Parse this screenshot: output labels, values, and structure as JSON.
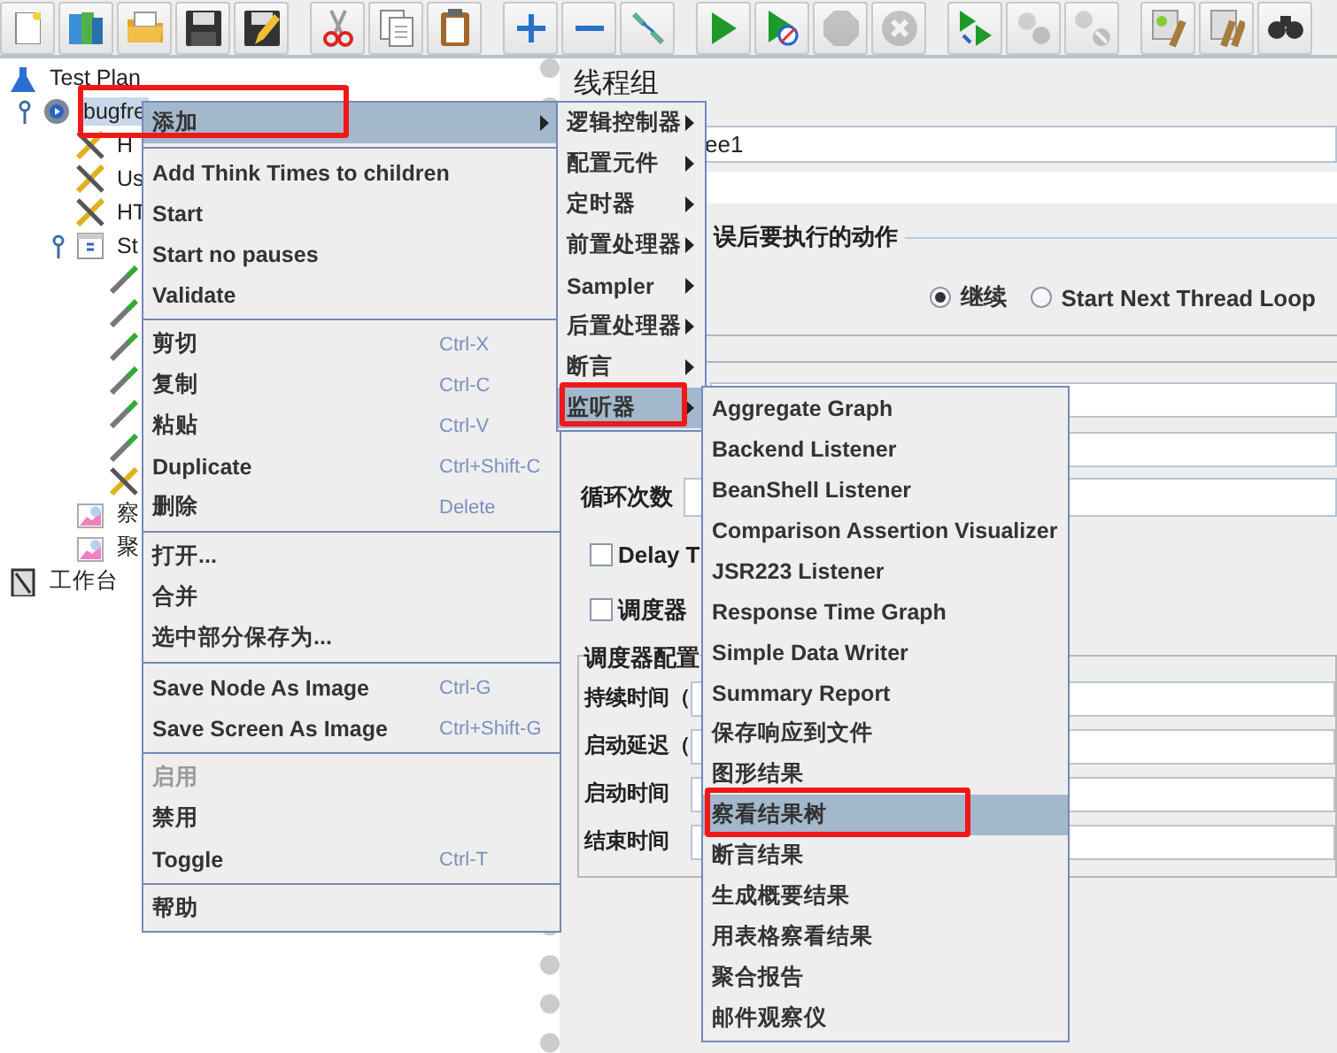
{
  "toolbar": [
    [
      {
        "kind": "new",
        "disabled": false
      },
      {
        "kind": "templates",
        "disabled": false
      },
      {
        "kind": "open",
        "disabled": false
      },
      {
        "kind": "save",
        "disabled": false
      },
      {
        "kind": "save-as",
        "disabled": false
      }
    ],
    [
      {
        "kind": "cut",
        "disabled": false
      },
      {
        "kind": "copy",
        "disabled": false
      },
      {
        "kind": "paste",
        "disabled": false
      }
    ],
    [
      {
        "kind": "expand",
        "disabled": false
      },
      {
        "kind": "collapse",
        "disabled": false
      },
      {
        "kind": "toggle",
        "disabled": false
      }
    ],
    [
      {
        "kind": "start",
        "disabled": false
      },
      {
        "kind": "start-no-pauses",
        "disabled": false
      },
      {
        "kind": "stop",
        "disabled": true
      },
      {
        "kind": "shutdown",
        "disabled": true
      }
    ],
    [
      {
        "kind": "remote-start",
        "disabled": false
      },
      {
        "kind": "remote-stop",
        "disabled": true
      },
      {
        "kind": "remote-shutdown",
        "disabled": true
      }
    ],
    [
      {
        "kind": "clear",
        "disabled": false
      },
      {
        "kind": "clear-all",
        "disabled": false
      },
      {
        "kind": "search",
        "disabled": false
      }
    ]
  ],
  "tree": [
    {
      "label": "Test Plan",
      "kind": "test-plan",
      "selected": false,
      "children": [
        {
          "label": "bugfre",
          "kind": "thread-group",
          "selected": true,
          "expanded": true,
          "children": [
            {
              "label": "H",
              "kind": "config",
              "selected": false
            },
            {
              "label": "Us",
              "kind": "config",
              "selected": false
            },
            {
              "label": "HT",
              "kind": "config",
              "selected": false
            },
            {
              "label": "St",
              "kind": "controller",
              "selected": false,
              "expanded": true,
              "children": [
                {
                  "kind": "sampler",
                  "selected": false
                },
                {
                  "kind": "sampler",
                  "selected": false
                },
                {
                  "kind": "sampler",
                  "selected": false
                },
                {
                  "kind": "sampler",
                  "selected": false
                },
                {
                  "kind": "sampler",
                  "selected": false
                },
                {
                  "kind": "sampler",
                  "selected": false
                },
                {
                  "kind": "config",
                  "selected": false
                }
              ]
            },
            {
              "label": "察",
              "kind": "listener",
              "selected": false
            },
            {
              "label": "聚",
              "kind": "listener",
              "selected": false
            }
          ]
        }
      ]
    },
    {
      "label": "工作台",
      "kind": "workbench",
      "selected": false
    }
  ],
  "editor": {
    "title": "线程组",
    "name_value": "ee1",
    "error_section": "误后要执行的动作",
    "error_actions": [
      {
        "label": "继续",
        "selected": true
      },
      {
        "label": "Start Next Thread Loop",
        "selected": false
      }
    ],
    "loop_label": "循环次数",
    "options": [
      {
        "label": "Delay T",
        "checked": false
      },
      {
        "label": "调度器",
        "checked": false
      }
    ],
    "scheduler": {
      "title": "调度器配置",
      "rows": [
        "持续时间（",
        "启动延迟（",
        "启动时间",
        "结束时间"
      ]
    }
  },
  "menus": [
    {
      "groups": [
        [
          {
            "label": "添加",
            "submenu": true,
            "selected": true,
            "disabled": false,
            "annotated": true
          }
        ],
        [
          {
            "label": "Add Think Times to children",
            "submenu": false,
            "selected": false,
            "disabled": false,
            "annotated": false
          },
          {
            "label": "Start",
            "submenu": false,
            "selected": false,
            "disabled": false,
            "annotated": false
          },
          {
            "label": "Start no pauses",
            "submenu": false,
            "selected": false,
            "disabled": false,
            "annotated": false
          },
          {
            "label": "Validate",
            "submenu": false,
            "selected": false,
            "disabled": false,
            "annotated": false
          }
        ],
        [
          {
            "label": "剪切",
            "shortcut": "Ctrl-X",
            "submenu": false,
            "selected": false,
            "disabled": false,
            "annotated": false
          },
          {
            "label": "复制",
            "shortcut": "Ctrl-C",
            "submenu": false,
            "selected": false,
            "disabled": false,
            "annotated": false
          },
          {
            "label": "粘贴",
            "shortcut": "Ctrl-V",
            "submenu": false,
            "selected": false,
            "disabled": false,
            "annotated": false
          },
          {
            "label": "Duplicate",
            "shortcut": "Ctrl+Shift-C",
            "submenu": false,
            "selected": false,
            "disabled": false,
            "annotated": false
          },
          {
            "label": "删除",
            "shortcut": "Delete",
            "submenu": false,
            "selected": false,
            "disabled": false,
            "annotated": false
          }
        ],
        [
          {
            "label": "打开...",
            "submenu": false,
            "selected": false,
            "disabled": false,
            "annotated": false
          },
          {
            "label": "合并",
            "submenu": false,
            "selected": false,
            "disabled": false,
            "annotated": false
          },
          {
            "label": "选中部分保存为...",
            "submenu": false,
            "selected": false,
            "disabled": false,
            "annotated": false
          }
        ],
        [
          {
            "label": "Save Node As Image",
            "shortcut": "Ctrl-G",
            "submenu": false,
            "selected": false,
            "disabled": false,
            "annotated": false
          },
          {
            "label": "Save Screen As Image",
            "shortcut": "Ctrl+Shift-G",
            "submenu": false,
            "selected": false,
            "disabled": false,
            "annotated": false
          }
        ],
        [
          {
            "label": "启用",
            "submenu": false,
            "selected": false,
            "disabled": true,
            "annotated": false
          },
          {
            "label": "禁用",
            "submenu": false,
            "selected": false,
            "disabled": false,
            "annotated": false
          },
          {
            "label": "Toggle",
            "shortcut": "Ctrl-T",
            "submenu": false,
            "selected": false,
            "disabled": false,
            "annotated": false
          }
        ],
        [
          {
            "label": "帮助",
            "submenu": false,
            "selected": false,
            "disabled": false,
            "annotated": false
          }
        ]
      ]
    },
    {
      "groups": [
        [
          {
            "label": "逻辑控制器",
            "submenu": true,
            "selected": false,
            "disabled": false,
            "annotated": false
          },
          {
            "label": "配置元件",
            "submenu": true,
            "selected": false,
            "disabled": false,
            "annotated": false
          },
          {
            "label": "定时器",
            "submenu": true,
            "selected": false,
            "disabled": false,
            "annotated": false
          },
          {
            "label": "前置处理器",
            "submenu": true,
            "selected": false,
            "disabled": false,
            "annotated": false
          },
          {
            "label": "Sampler",
            "submenu": true,
            "selected": false,
            "disabled": false,
            "annotated": false
          },
          {
            "label": "后置处理器",
            "submenu": true,
            "selected": false,
            "disabled": false,
            "annotated": false
          },
          {
            "label": "断言",
            "submenu": true,
            "selected": false,
            "disabled": false,
            "annotated": false
          },
          {
            "label": "监听器",
            "submenu": true,
            "selected": true,
            "disabled": false,
            "annotated": true
          }
        ]
      ]
    },
    {
      "groups": [
        [
          {
            "label": "Aggregate Graph",
            "submenu": false,
            "selected": false,
            "disabled": false,
            "annotated": false
          },
          {
            "label": "Backend Listener",
            "submenu": false,
            "selected": false,
            "disabled": false,
            "annotated": false
          },
          {
            "label": "BeanShell Listener",
            "submenu": false,
            "selected": false,
            "disabled": false,
            "annotated": false
          },
          {
            "label": "Comparison Assertion Visualizer",
            "submenu": false,
            "selected": false,
            "disabled": false,
            "annotated": false
          },
          {
            "label": "JSR223 Listener",
            "submenu": false,
            "selected": false,
            "disabled": false,
            "annotated": false
          },
          {
            "label": "Response Time Graph",
            "submenu": false,
            "selected": false,
            "disabled": false,
            "annotated": false
          },
          {
            "label": "Simple Data Writer",
            "submenu": false,
            "selected": false,
            "disabled": false,
            "annotated": false
          },
          {
            "label": "Summary Report",
            "submenu": false,
            "selected": false,
            "disabled": false,
            "annotated": false
          },
          {
            "label": "保存响应到文件",
            "submenu": false,
            "selected": false,
            "disabled": false,
            "annotated": false
          },
          {
            "label": "图形结果",
            "submenu": false,
            "selected": false,
            "disabled": false,
            "annotated": false
          },
          {
            "label": "察看结果树",
            "submenu": false,
            "selected": true,
            "disabled": false,
            "annotated": true
          },
          {
            "label": "断言结果",
            "submenu": false,
            "selected": false,
            "disabled": false,
            "annotated": false
          },
          {
            "label": "生成概要结果",
            "submenu": false,
            "selected": false,
            "disabled": false,
            "annotated": false
          },
          {
            "label": "用表格察看结果",
            "submenu": false,
            "selected": false,
            "disabled": false,
            "annotated": false
          },
          {
            "label": "聚合报告",
            "submenu": false,
            "selected": false,
            "disabled": false,
            "annotated": false
          },
          {
            "label": "邮件观察仪",
            "submenu": false,
            "selected": false,
            "disabled": false,
            "annotated": false
          }
        ]
      ]
    }
  ]
}
